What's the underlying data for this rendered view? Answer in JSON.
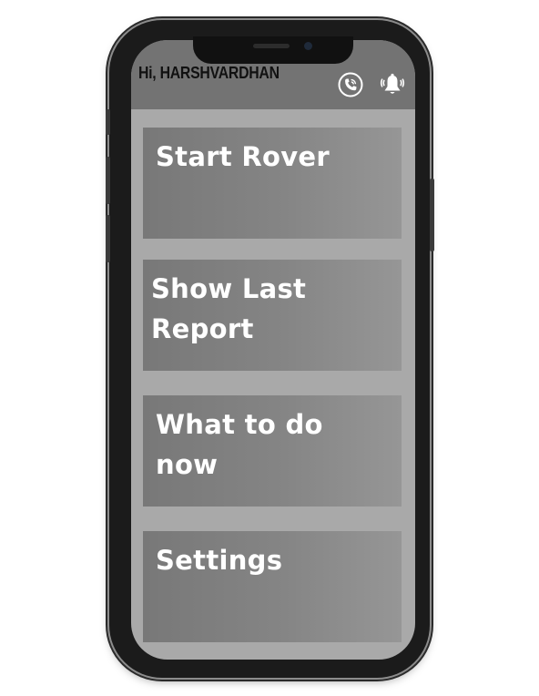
{
  "header": {
    "greeting": "Hi, HARSHVARDHAN",
    "call_icon": "phone-call-icon",
    "alarm_icon": "alarm-bell-icon"
  },
  "menu": {
    "items": [
      {
        "label": "Start Rover"
      },
      {
        "label": "Show Last Report"
      },
      {
        "label": "What to do now"
      },
      {
        "label": "Settings"
      }
    ]
  },
  "colors": {
    "header_bg": "#737373",
    "screen_bg": "#a9a9a9",
    "card_bg": "#858585",
    "card_text": "#ffffff",
    "greeting_text": "#111111",
    "phone_frame": "#1b1b1b"
  }
}
